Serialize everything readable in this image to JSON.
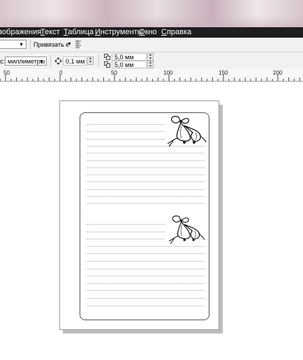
{
  "menu": {
    "items": [
      {
        "id": "image",
        "label": "зображения",
        "ul": ""
      },
      {
        "id": "text",
        "label": "екст",
        "ul": "Т"
      },
      {
        "id": "table",
        "label": "аблица",
        "ul": "Т"
      },
      {
        "id": "tools",
        "label": "нструменты",
        "ul": "И"
      },
      {
        "id": "window",
        "label": "кно",
        "ul": "О"
      },
      {
        "id": "help",
        "label": "правка",
        "ul": "С"
      }
    ]
  },
  "toolbar": {
    "snap_label": "Привязать к",
    "units_prefix": "с:",
    "units_value": "миллиметры",
    "nudge_value": "0,1 мм",
    "dup_x_value": "5,0 мм",
    "dup_y_value": "5,0 мм"
  },
  "ruler": {
    "labels": [
      "50",
      "0",
      "50",
      "100",
      "150",
      "200"
    ]
  },
  "colors": {
    "menubar": "#1e1e1e",
    "toolbar": "#f1f1f1",
    "page_border": "#9b9b9b",
    "frame_border": "#555555"
  },
  "document": {
    "decoration": "bell-bow-clipart",
    "ruled_lines_upper": 12,
    "ruled_lines_lower": 12
  }
}
